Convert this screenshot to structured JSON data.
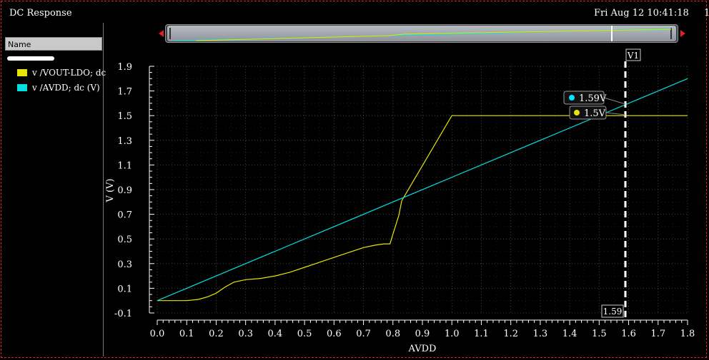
{
  "window": {
    "title": "DC Response",
    "datetime": "Fri Aug 12 10:41:18",
    "page_num": "1"
  },
  "legend": {
    "header": "Name",
    "items": [
      {
        "label": "v /VOUT-LDO; dc",
        "color": "#e6e600"
      },
      {
        "label": "v /AVDD; dc (V)",
        "color": "#00e0e0"
      }
    ]
  },
  "cursor": {
    "name": "V1",
    "x_value": "1.59",
    "markers": [
      {
        "label": "1.59V",
        "color": "#00e5ff"
      },
      {
        "label": "1.5V",
        "color": "#e6e600"
      }
    ]
  },
  "chart_data": {
    "type": "line",
    "xlabel": "AVDD",
    "ylabel": "V (V)",
    "xlim": [
      0.0,
      1.8
    ],
    "ylim": [
      -0.1,
      1.9
    ],
    "x_ticks": [
      "0.0",
      "0.1",
      "0.2",
      "0.3",
      "0.4",
      "0.5",
      "0.6",
      "0.7",
      "0.8",
      "0.9",
      "1.0",
      "1.1",
      "1.2",
      "1.3",
      "1.4",
      "1.5",
      "1.6",
      "1.7",
      "1.8"
    ],
    "y_ticks": [
      "1.9",
      "1.7",
      "1.5",
      "1.3",
      "1.1",
      "0.9",
      "0.7",
      "0.5",
      "0.3",
      "0.1",
      "-0.1"
    ],
    "grid": true,
    "series": [
      {
        "name": "v /VOUT-LDO; dc",
        "color": "#e6e600",
        "x": [
          0.0,
          0.05,
          0.1,
          0.14,
          0.17,
          0.2,
          0.23,
          0.26,
          0.3,
          0.35,
          0.4,
          0.45,
          0.5,
          0.55,
          0.6,
          0.65,
          0.7,
          0.74,
          0.77,
          0.79,
          0.8,
          0.82,
          0.83,
          1.0,
          1.2,
          1.4,
          1.6,
          1.8
        ],
        "y": [
          0.0,
          0.0,
          0.0,
          0.01,
          0.03,
          0.06,
          0.11,
          0.15,
          0.17,
          0.18,
          0.2,
          0.23,
          0.27,
          0.31,
          0.35,
          0.39,
          0.43,
          0.45,
          0.46,
          0.46,
          0.54,
          0.69,
          0.81,
          1.5,
          1.5,
          1.5,
          1.5,
          1.5
        ]
      },
      {
        "name": "v /AVDD; dc (V)",
        "color": "#00e0e0",
        "x": [
          0.0,
          1.8
        ],
        "y": [
          0.0,
          1.8
        ]
      }
    ]
  }
}
